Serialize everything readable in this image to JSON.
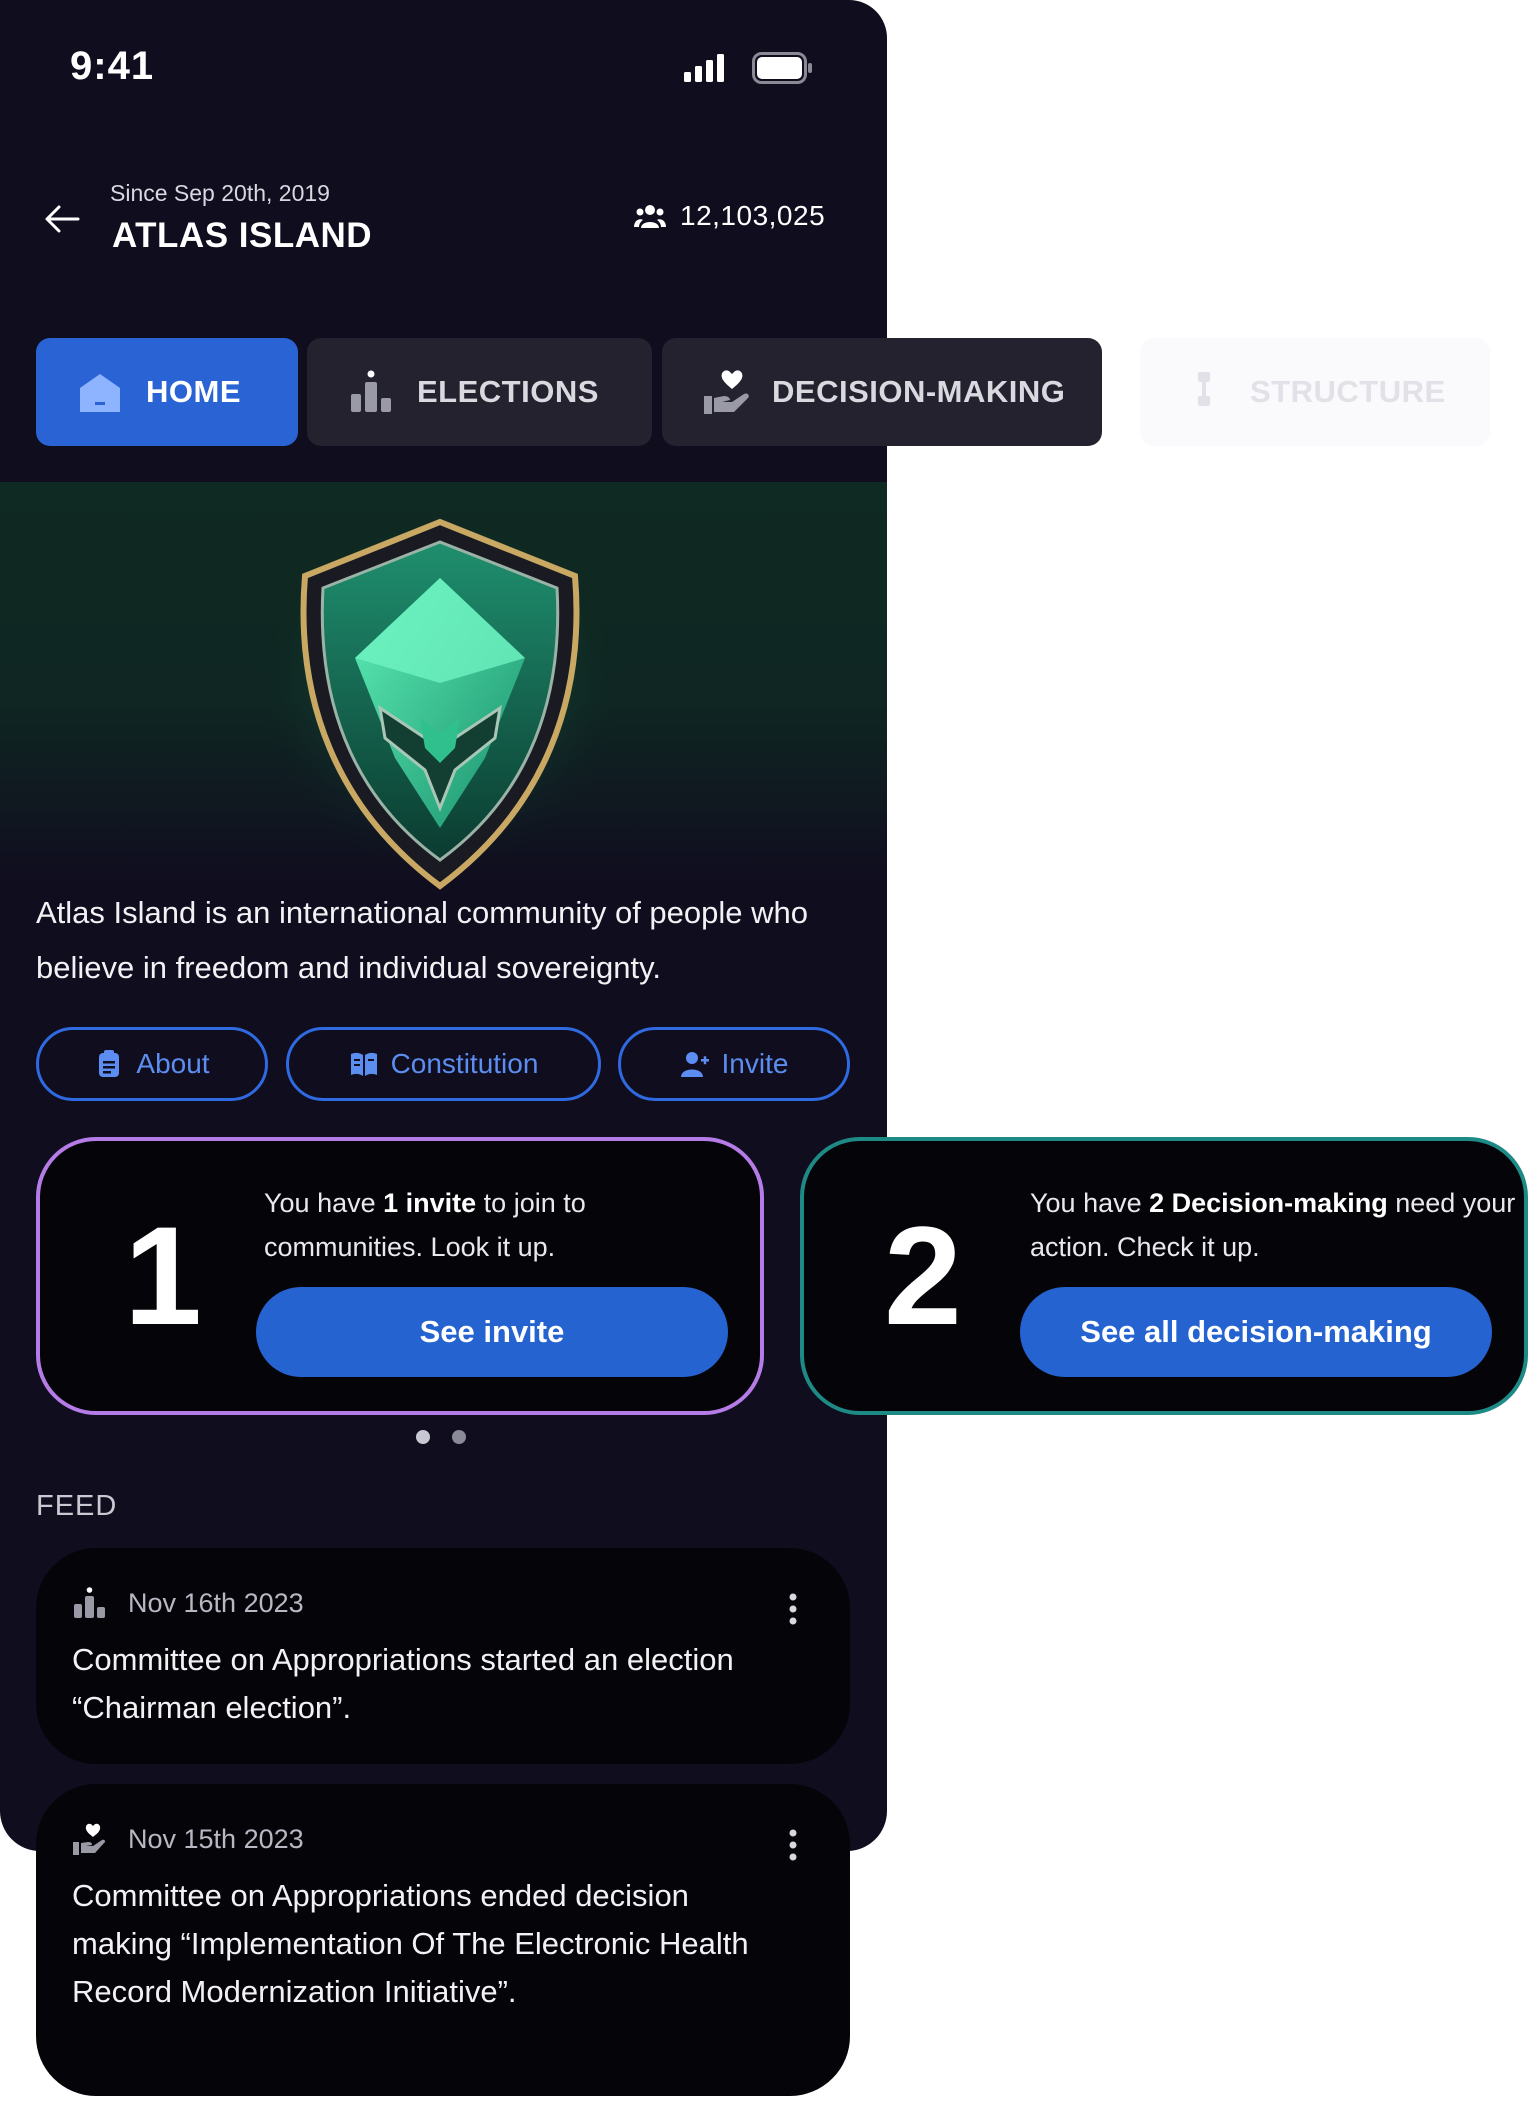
{
  "status": {
    "time": "9:41"
  },
  "header": {
    "since": "Since Sep 20th, 2019",
    "title": "ATLAS ISLAND",
    "member_count": "12,103,025"
  },
  "tabs": [
    {
      "label": "HOME",
      "icon": "home-icon",
      "active": true
    },
    {
      "label": "ELECTIONS",
      "icon": "ballot-icon",
      "active": false
    },
    {
      "label": "DECISION-MAKING",
      "icon": "heart-hand-icon",
      "active": false
    },
    {
      "label": "STRUCTURE",
      "icon": "structure-icon",
      "active": false
    }
  ],
  "about": {
    "description": "Atlas Island is an international community of people who believe in freedom and individual sovereignty."
  },
  "actions": {
    "about_label": "About",
    "constitution_label": "Constitution",
    "invite_label": "Invite"
  },
  "cards": [
    {
      "number": "1",
      "msg_pre": "You have ",
      "msg_bold": "1 invite",
      "msg_post": " to join to communities. Look it up.",
      "button": "See invite"
    },
    {
      "number": "2",
      "msg_pre": "You have ",
      "msg_bold": "2 Decision-making",
      "msg_post": " need your action. Check it up.",
      "button": "See all decision-making"
    }
  ],
  "feed": {
    "label": "FEED",
    "items": [
      {
        "date": "Nov 16th 2023",
        "icon": "ballot-icon",
        "text": "Committee on Appropriations started an election “Chairman election”."
      },
      {
        "date": "Nov 15th 2023",
        "icon": "heart-hand-icon",
        "text": "Committee on Appropriations ended decision making “Implementation Of The Electronic Health Record Modernization Initiative”."
      }
    ]
  },
  "colors": {
    "background": "#100d1f",
    "accent": "#2a63d4",
    "card1_border": "#b57ce8",
    "card2_border": "#1d8a86"
  }
}
